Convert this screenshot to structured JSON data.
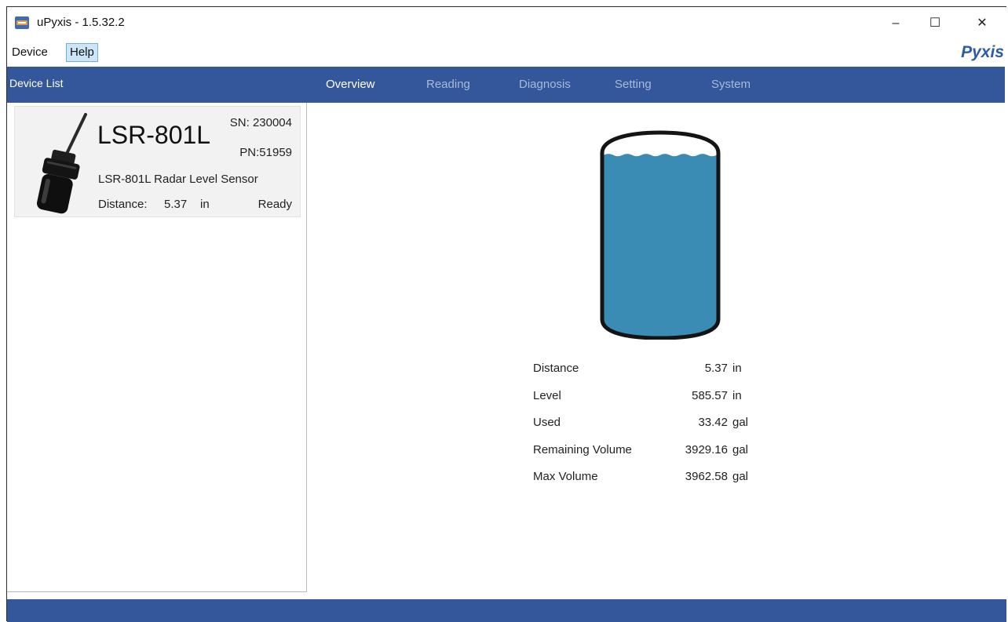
{
  "window": {
    "title": "uPyxis - 1.5.32.2",
    "controls": {
      "minimize": "–",
      "maximize": "☐",
      "close": "✕"
    }
  },
  "menu": {
    "items": [
      {
        "label": "Device"
      },
      {
        "label": "Help"
      }
    ]
  },
  "brand": {
    "name": "Pyxis"
  },
  "sidebar": {
    "header": "Device List",
    "device": {
      "model": "LSR-801L",
      "sn": "SN: 230004",
      "pn": "PN:51959",
      "description": "LSR-801L Radar Level Sensor",
      "distance_label": "Distance:",
      "distance_value": "5.37",
      "distance_unit": "in",
      "status": "Ready"
    }
  },
  "tabs": [
    {
      "label": "Overview",
      "active": true
    },
    {
      "label": "Reading",
      "active": false
    },
    {
      "label": "Diagnosis",
      "active": false
    },
    {
      "label": "Setting",
      "active": false
    },
    {
      "label": "System",
      "active": false
    }
  ],
  "overview": {
    "tank": {
      "fill_fraction": 0.98,
      "liquid_color": "#3b8cb5"
    },
    "rows": [
      {
        "label": "Distance",
        "value": "5.37",
        "unit": "in"
      },
      {
        "label": "Level",
        "value": "585.57",
        "unit": "in"
      },
      {
        "label": "Used",
        "value": "33.42",
        "unit": "gal"
      },
      {
        "label": "Remaining Volume",
        "value": "3929.16",
        "unit": "gal"
      },
      {
        "label": "Max Volume",
        "value": "3962.58",
        "unit": "gal"
      }
    ]
  },
  "colors": {
    "header_bar": "#34579c",
    "brand": "#2e5aa8",
    "menu_active": "#cde6f7"
  }
}
